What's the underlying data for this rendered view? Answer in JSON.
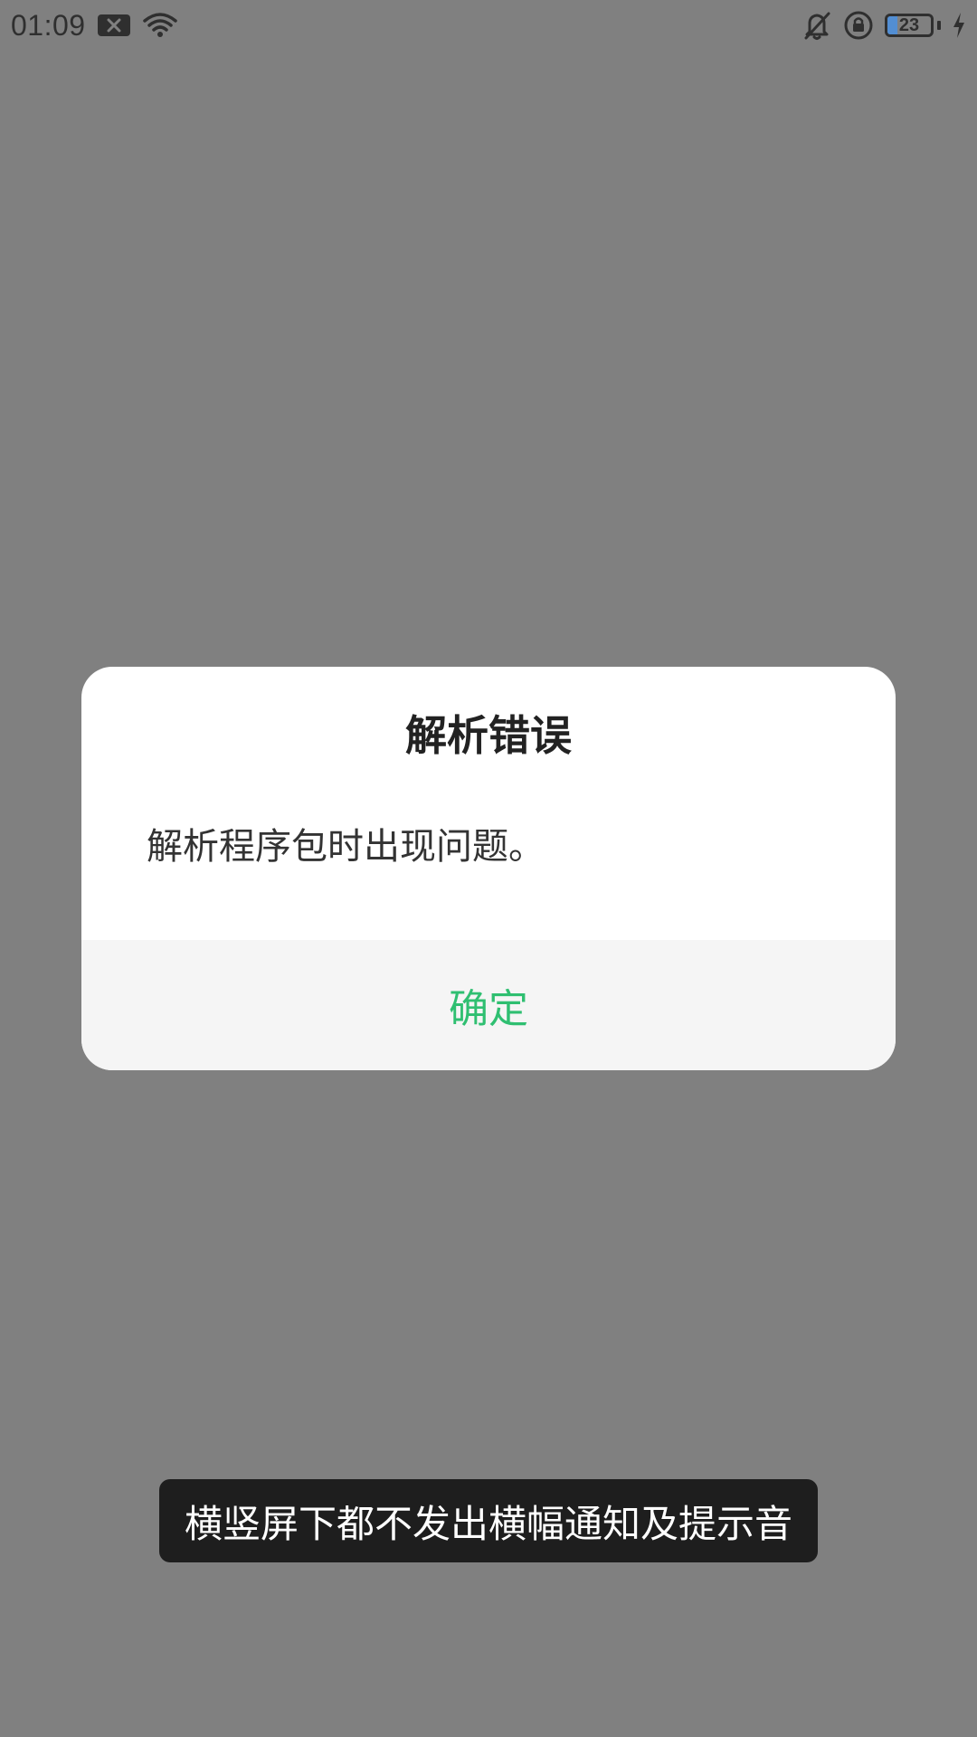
{
  "status_bar": {
    "time": "01:09",
    "battery_level": "23",
    "battery_fraction": 0.23,
    "icons": {
      "notification": "x-notification-icon",
      "wifi": "wifi-icon",
      "silent": "bell-off-icon",
      "rotation_lock": "rotation-lock-icon",
      "battery": "battery-icon",
      "charging": "charging-bolt-icon"
    }
  },
  "dialog": {
    "title": "解析错误",
    "message": "解析程序包时出现问题。",
    "confirm_label": "确定"
  },
  "toast": {
    "text": "横竖屏下都不发出横幅通知及提示音"
  },
  "colors": {
    "background_dim": "#808080",
    "dialog_bg": "#ffffff",
    "footer_bg": "#f5f5f5",
    "accent": "#2fbf71",
    "toast_bg": "#1e1e1e"
  }
}
